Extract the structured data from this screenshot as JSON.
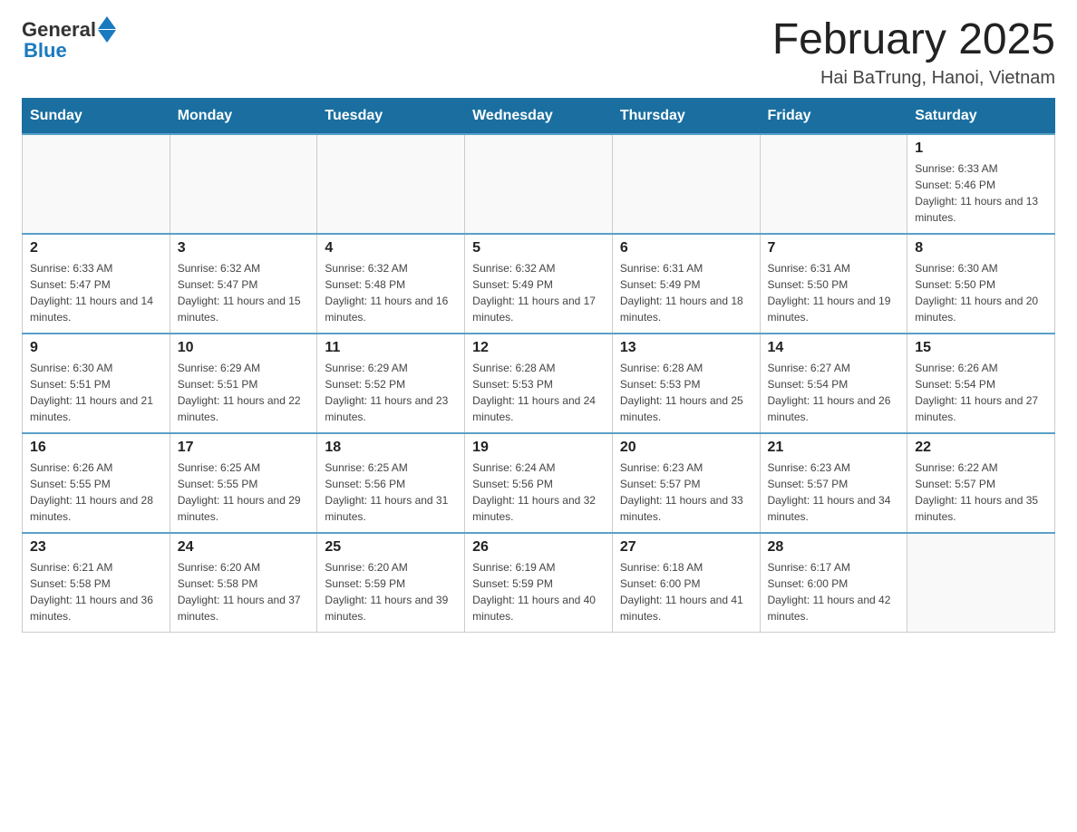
{
  "header": {
    "logo_general": "General",
    "logo_blue": "Blue",
    "month_title": "February 2025",
    "location": "Hai BaTrung, Hanoi, Vietnam"
  },
  "weekdays": [
    "Sunday",
    "Monday",
    "Tuesday",
    "Wednesday",
    "Thursday",
    "Friday",
    "Saturday"
  ],
  "weeks": [
    [
      {
        "day": "",
        "info": ""
      },
      {
        "day": "",
        "info": ""
      },
      {
        "day": "",
        "info": ""
      },
      {
        "day": "",
        "info": ""
      },
      {
        "day": "",
        "info": ""
      },
      {
        "day": "",
        "info": ""
      },
      {
        "day": "1",
        "info": "Sunrise: 6:33 AM\nSunset: 5:46 PM\nDaylight: 11 hours and 13 minutes."
      }
    ],
    [
      {
        "day": "2",
        "info": "Sunrise: 6:33 AM\nSunset: 5:47 PM\nDaylight: 11 hours and 14 minutes."
      },
      {
        "day": "3",
        "info": "Sunrise: 6:32 AM\nSunset: 5:47 PM\nDaylight: 11 hours and 15 minutes."
      },
      {
        "day": "4",
        "info": "Sunrise: 6:32 AM\nSunset: 5:48 PM\nDaylight: 11 hours and 16 minutes."
      },
      {
        "day": "5",
        "info": "Sunrise: 6:32 AM\nSunset: 5:49 PM\nDaylight: 11 hours and 17 minutes."
      },
      {
        "day": "6",
        "info": "Sunrise: 6:31 AM\nSunset: 5:49 PM\nDaylight: 11 hours and 18 minutes."
      },
      {
        "day": "7",
        "info": "Sunrise: 6:31 AM\nSunset: 5:50 PM\nDaylight: 11 hours and 19 minutes."
      },
      {
        "day": "8",
        "info": "Sunrise: 6:30 AM\nSunset: 5:50 PM\nDaylight: 11 hours and 20 minutes."
      }
    ],
    [
      {
        "day": "9",
        "info": "Sunrise: 6:30 AM\nSunset: 5:51 PM\nDaylight: 11 hours and 21 minutes."
      },
      {
        "day": "10",
        "info": "Sunrise: 6:29 AM\nSunset: 5:51 PM\nDaylight: 11 hours and 22 minutes."
      },
      {
        "day": "11",
        "info": "Sunrise: 6:29 AM\nSunset: 5:52 PM\nDaylight: 11 hours and 23 minutes."
      },
      {
        "day": "12",
        "info": "Sunrise: 6:28 AM\nSunset: 5:53 PM\nDaylight: 11 hours and 24 minutes."
      },
      {
        "day": "13",
        "info": "Sunrise: 6:28 AM\nSunset: 5:53 PM\nDaylight: 11 hours and 25 minutes."
      },
      {
        "day": "14",
        "info": "Sunrise: 6:27 AM\nSunset: 5:54 PM\nDaylight: 11 hours and 26 minutes."
      },
      {
        "day": "15",
        "info": "Sunrise: 6:26 AM\nSunset: 5:54 PM\nDaylight: 11 hours and 27 minutes."
      }
    ],
    [
      {
        "day": "16",
        "info": "Sunrise: 6:26 AM\nSunset: 5:55 PM\nDaylight: 11 hours and 28 minutes."
      },
      {
        "day": "17",
        "info": "Sunrise: 6:25 AM\nSunset: 5:55 PM\nDaylight: 11 hours and 29 minutes."
      },
      {
        "day": "18",
        "info": "Sunrise: 6:25 AM\nSunset: 5:56 PM\nDaylight: 11 hours and 31 minutes."
      },
      {
        "day": "19",
        "info": "Sunrise: 6:24 AM\nSunset: 5:56 PM\nDaylight: 11 hours and 32 minutes."
      },
      {
        "day": "20",
        "info": "Sunrise: 6:23 AM\nSunset: 5:57 PM\nDaylight: 11 hours and 33 minutes."
      },
      {
        "day": "21",
        "info": "Sunrise: 6:23 AM\nSunset: 5:57 PM\nDaylight: 11 hours and 34 minutes."
      },
      {
        "day": "22",
        "info": "Sunrise: 6:22 AM\nSunset: 5:57 PM\nDaylight: 11 hours and 35 minutes."
      }
    ],
    [
      {
        "day": "23",
        "info": "Sunrise: 6:21 AM\nSunset: 5:58 PM\nDaylight: 11 hours and 36 minutes."
      },
      {
        "day": "24",
        "info": "Sunrise: 6:20 AM\nSunset: 5:58 PM\nDaylight: 11 hours and 37 minutes."
      },
      {
        "day": "25",
        "info": "Sunrise: 6:20 AM\nSunset: 5:59 PM\nDaylight: 11 hours and 39 minutes."
      },
      {
        "day": "26",
        "info": "Sunrise: 6:19 AM\nSunset: 5:59 PM\nDaylight: 11 hours and 40 minutes."
      },
      {
        "day": "27",
        "info": "Sunrise: 6:18 AM\nSunset: 6:00 PM\nDaylight: 11 hours and 41 minutes."
      },
      {
        "day": "28",
        "info": "Sunrise: 6:17 AM\nSunset: 6:00 PM\nDaylight: 11 hours and 42 minutes."
      },
      {
        "day": "",
        "info": ""
      }
    ]
  ]
}
